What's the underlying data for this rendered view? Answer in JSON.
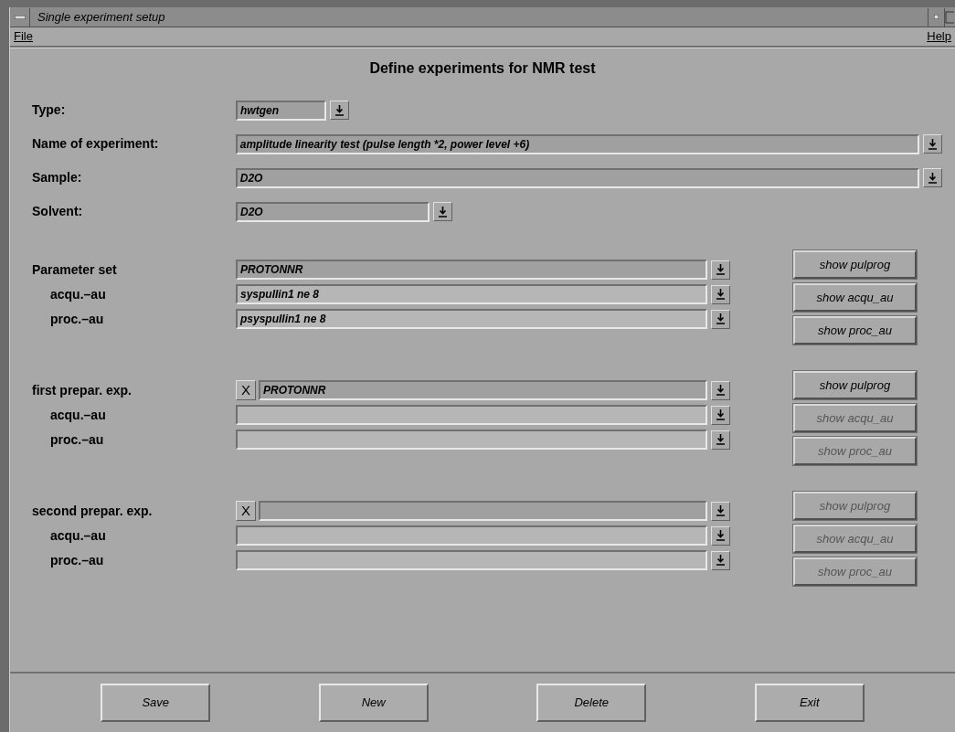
{
  "window": {
    "title": "Single experiment setup"
  },
  "menu": [
    {
      "label": "File"
    },
    {
      "label": "Help"
    }
  ],
  "header": "Define experiments for NMR test",
  "fields": [
    {
      "label": "Type:",
      "value": "hwtgen",
      "kind": "short"
    },
    {
      "label": "Name of experiment:",
      "value": "amplitude linearity test (pulse length *2, power level +6)",
      "kind": "full"
    },
    {
      "label": "Sample:",
      "value": "D2O",
      "kind": "full"
    },
    {
      "label": "Solvent:",
      "value": "D2O",
      "kind": "medium"
    }
  ],
  "groups": [
    {
      "rows": [
        {
          "label": "Parameter set",
          "value": "PROTONNR",
          "editable": false
        },
        {
          "label": "acqu.–au",
          "value": "syspullin1 ne 8",
          "editable": true
        },
        {
          "label": "proc.–au",
          "value": "psyspullin1 ne 8",
          "editable": true
        }
      ],
      "buttons": [
        {
          "label": "show pulprog",
          "disabled": false
        },
        {
          "label": "show acqu_au",
          "disabled": false
        },
        {
          "label": "show proc_au",
          "disabled": false
        }
      ]
    },
    {
      "rows": [
        {
          "label": "first prepar. exp.",
          "value": "PROTONNR",
          "editable": false,
          "toggle": {
            "mark": "X",
            "checked": true
          }
        },
        {
          "label": "acqu.–au",
          "editable": true
        },
        {
          "label": "proc.–au",
          "editable": true
        }
      ],
      "buttons": [
        {
          "label": "show pulprog",
          "disabled": false
        },
        {
          "label": "show acqu_au",
          "disabled": true
        },
        {
          "label": "show proc_au",
          "disabled": true
        }
      ]
    },
    {
      "rows": [
        {
          "label": "second prepar. exp.",
          "editable": false,
          "toggle": {
            "mark": "X",
            "checked": true
          }
        },
        {
          "label": "acqu.–au",
          "editable": true
        },
        {
          "label": "proc.–au",
          "editable": true
        }
      ],
      "buttons": [
        {
          "label": "show pulprog",
          "disabled": true
        },
        {
          "label": "show acqu_au",
          "disabled": true
        },
        {
          "label": "show proc_au",
          "disabled": true
        }
      ]
    }
  ],
  "footer_buttons": [
    {
      "label": "Save"
    },
    {
      "label": "New"
    },
    {
      "label": "Delete"
    },
    {
      "label": "Exit"
    }
  ]
}
